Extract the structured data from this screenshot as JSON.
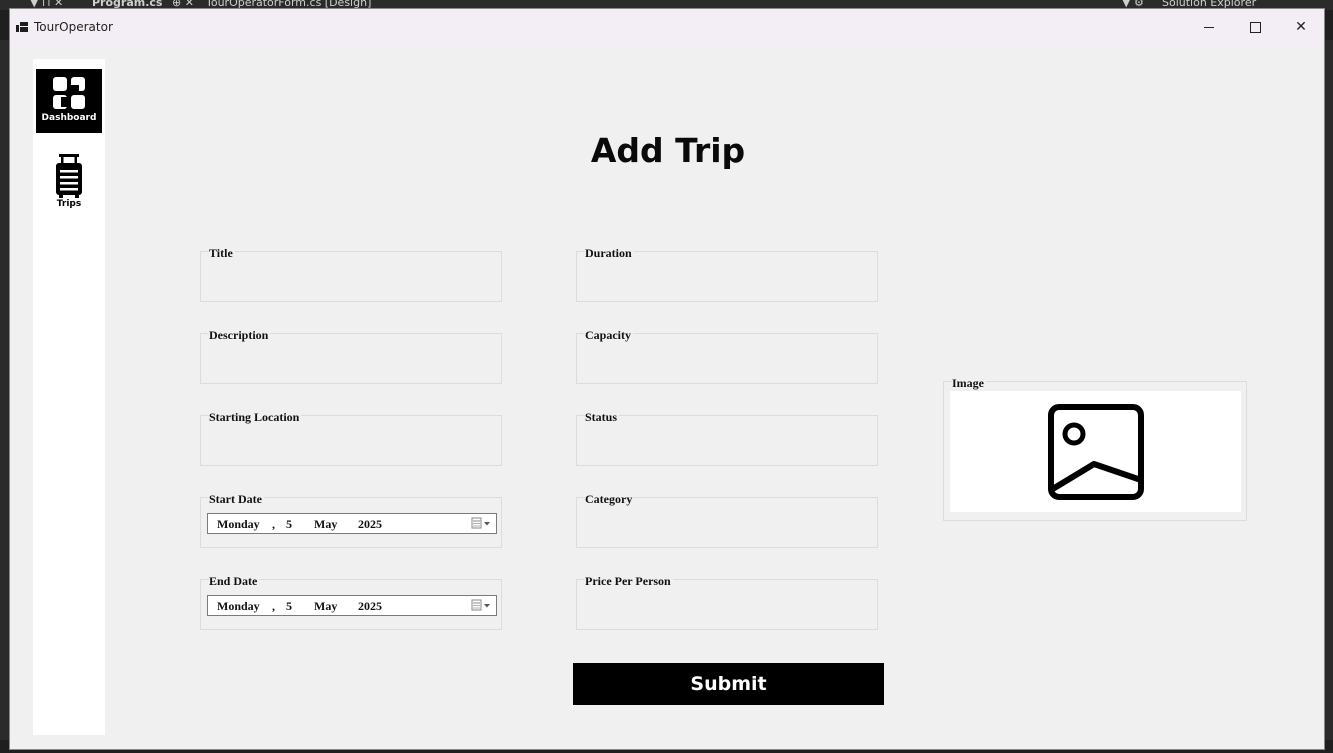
{
  "background": {
    "tabs": [
      "▼ ⊓ ✕",
      "Program.cs",
      "⊕ ✕",
      "TourOperatorForm.cs [Design]",
      "▼ ⚙",
      "Solution Explorer"
    ]
  },
  "window": {
    "title": "TourOperator",
    "minimize": "—",
    "maximize": "☐",
    "close": "✕"
  },
  "sidebar": {
    "items": [
      {
        "label": "Dashboard",
        "icon": "dashboard-icon",
        "active": true
      },
      {
        "label": "Trips",
        "icon": "luggage-icon",
        "active": false
      }
    ]
  },
  "form": {
    "title": "Add Trip",
    "left_fields": [
      {
        "label": "Title",
        "value": ""
      },
      {
        "label": "Description",
        "value": ""
      },
      {
        "label": "Starting Location",
        "value": ""
      }
    ],
    "start_date": {
      "label": "Start Date",
      "day_name": "Monday",
      "sep": ",",
      "day": "5",
      "month": "May",
      "year": "2025"
    },
    "end_date": {
      "label": "End Date",
      "day_name": "Monday",
      "sep": ",",
      "day": "5",
      "month": "May",
      "year": "2025"
    },
    "right_fields": [
      {
        "label": "Duration",
        "value": ""
      },
      {
        "label": "Capacity",
        "value": ""
      },
      {
        "label": "Status",
        "value": ""
      },
      {
        "label": "Category",
        "value": ""
      },
      {
        "label": "Price Per Person",
        "value": ""
      }
    ],
    "image": {
      "label": "Image",
      "icon": "image-placeholder-icon"
    },
    "submit_label": "Submit"
  },
  "colors": {
    "window_bg": "#f0f0f0",
    "titlebar_bg": "#f3eef5",
    "accent": "#000000",
    "sidebar_bg": "#ffffff"
  }
}
